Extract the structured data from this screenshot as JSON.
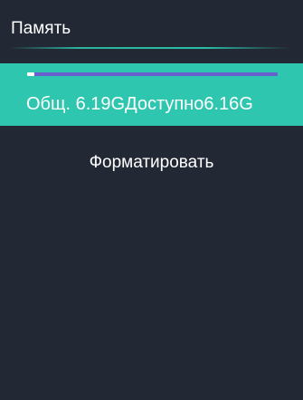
{
  "header": {
    "title": "Память"
  },
  "storage": {
    "total_label": "Общ.",
    "total_value": "6.19G",
    "available_label": "Доступно",
    "available_value": "6.16G",
    "used_fraction": 0.005
  },
  "actions": {
    "format_label": "Форматировать"
  },
  "colors": {
    "background": "#232835",
    "accent": "#2ec6ae",
    "progress_track": "#6b5fd0",
    "progress_fill": "#ffffff"
  }
}
